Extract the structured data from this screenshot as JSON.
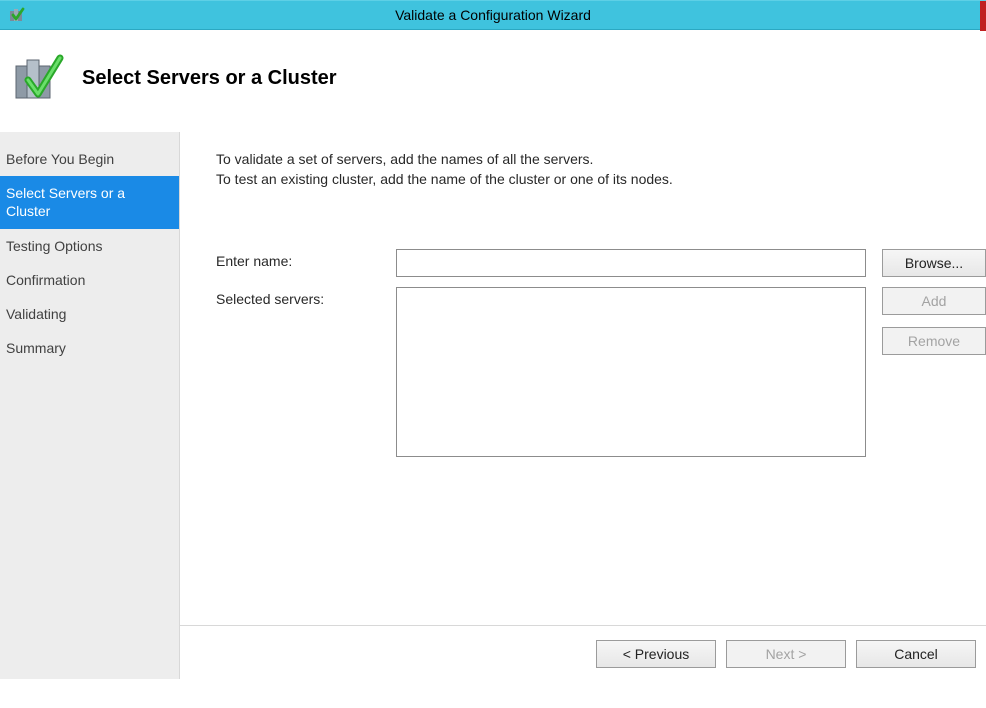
{
  "window": {
    "title": "Validate a Configuration Wizard"
  },
  "header": {
    "title": "Select Servers or a Cluster"
  },
  "sidebar": {
    "items": [
      {
        "label": "Before You Begin",
        "active": false
      },
      {
        "label": "Select Servers or a Cluster",
        "active": true
      },
      {
        "label": "Testing Options",
        "active": false
      },
      {
        "label": "Confirmation",
        "active": false
      },
      {
        "label": "Validating",
        "active": false
      },
      {
        "label": "Summary",
        "active": false
      }
    ]
  },
  "content": {
    "instruction_line1": "To validate a set of servers, add the names of all the servers.",
    "instruction_line2": "To test an existing cluster, add the name of the cluster or one of its nodes.",
    "enter_name_label": "Enter name:",
    "enter_name_value": "",
    "selected_servers_label": "Selected servers:",
    "browse_label": "Browse...",
    "add_label": "Add",
    "remove_label": "Remove"
  },
  "footer": {
    "previous_label": "< Previous",
    "next_label": "Next >",
    "cancel_label": "Cancel"
  }
}
